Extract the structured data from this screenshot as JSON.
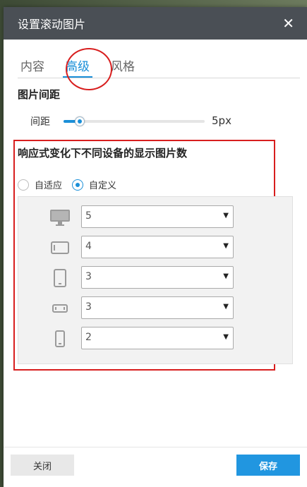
{
  "dialog": {
    "title": "设置滚动图片",
    "close_glyph": "✕"
  },
  "tabs": [
    {
      "label": "内容",
      "active": false
    },
    {
      "label": "高级",
      "active": true
    },
    {
      "label": "风格",
      "active": false
    }
  ],
  "spacing": {
    "section_title": "图片间距",
    "label": "间距",
    "value": "5px",
    "fraction": 0.07
  },
  "responsive": {
    "section_title": "响应式变化下不同设备的显示图片数",
    "modes": [
      {
        "label": "自适应",
        "checked": false
      },
      {
        "label": "自定义",
        "checked": true
      }
    ],
    "devices": [
      {
        "icon": "desktop-icon",
        "value": "5"
      },
      {
        "icon": "tablet-landscape-icon",
        "value": "4"
      },
      {
        "icon": "tablet-portrait-icon",
        "value": "3"
      },
      {
        "icon": "phone-landscape-icon",
        "value": "3"
      },
      {
        "icon": "phone-portrait-icon",
        "value": "2"
      }
    ]
  },
  "footer": {
    "close_label": "关闭",
    "save_label": "保存"
  },
  "colors": {
    "accent": "#1a8fd8",
    "annotation": "#d81e1e",
    "header": "#4a4f55"
  }
}
